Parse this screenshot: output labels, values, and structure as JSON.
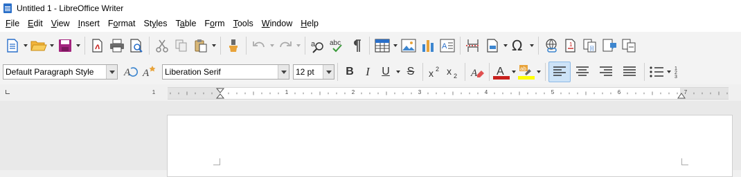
{
  "window": {
    "title": "Untitled 1 - LibreOffice Writer"
  },
  "menubar": {
    "items": [
      {
        "label": "File",
        "key": "F",
        "rest": "ile"
      },
      {
        "label": "Edit",
        "key": "E",
        "rest": "dit"
      },
      {
        "label": "View",
        "key": "V",
        "rest": "iew"
      },
      {
        "label": "Insert",
        "key": "I",
        "rest": "nsert"
      },
      {
        "label": "Format",
        "pre": "F",
        "key": "o",
        "rest": "rmat"
      },
      {
        "label": "Styles",
        "pre": "St",
        "key": "y",
        "rest": "les"
      },
      {
        "label": "Table",
        "pre": "T",
        "key": "a",
        "rest": "ble"
      },
      {
        "label": "Form",
        "pre": "F",
        "key": "o",
        "rest": "rm"
      },
      {
        "label": "Tools",
        "key": "T",
        "rest": "ools"
      },
      {
        "label": "Window",
        "key": "W",
        "rest": "indow"
      },
      {
        "label": "Help",
        "key": "H",
        "rest": "elp"
      }
    ]
  },
  "formatting": {
    "paragraph_style": "Default Paragraph Style",
    "font_name": "Liberation Serif",
    "font_size": "12 pt"
  },
  "ruler": {
    "numbers": [
      "1",
      "1",
      "2",
      "3",
      "4",
      "5",
      "6",
      "7"
    ]
  },
  "colors": {
    "font_color": "#c9211e",
    "highlight_color": "#ffff00",
    "accent": "#2a6fc9"
  }
}
